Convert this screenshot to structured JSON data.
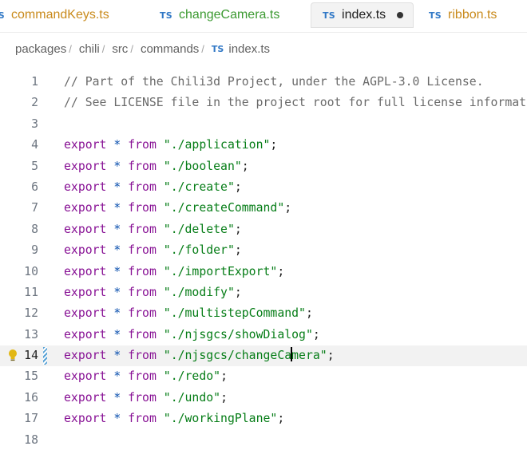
{
  "tabs": [
    {
      "label": "commandKeys.ts",
      "icon": "ts-icon",
      "icon_text": "TS",
      "state": "modified"
    },
    {
      "label": "changeCamera.ts",
      "icon": "ts-icon",
      "icon_text": "TS",
      "state": "renamed"
    },
    {
      "label": "index.ts",
      "icon": "ts-icon",
      "icon_text": "TS",
      "state": "active-unsaved"
    },
    {
      "label": "ribbon.ts",
      "icon": "ts-icon",
      "icon_text": "TS",
      "state": "modified"
    }
  ],
  "breadcrumb": {
    "items": [
      "packages",
      "chili",
      "src",
      "commands"
    ],
    "separator": "/",
    "file_icon_text": "TS",
    "file": "index.ts"
  },
  "editor": {
    "current_line": 14,
    "lines": [
      {
        "n": "1",
        "comment": "// Part of the Chili3d Project, under the AGPL-3.0 License."
      },
      {
        "n": "2",
        "comment": "// See LICENSE file in the project root for full license information."
      },
      {
        "n": "3"
      },
      {
        "n": "4",
        "kw": "export",
        "op": "*",
        "from": "from",
        "str": "\"./application\"",
        "end": ";"
      },
      {
        "n": "5",
        "kw": "export",
        "op": "*",
        "from": "from",
        "str": "\"./boolean\"",
        "end": ";"
      },
      {
        "n": "6",
        "kw": "export",
        "op": "*",
        "from": "from",
        "str": "\"./create\"",
        "end": ";"
      },
      {
        "n": "7",
        "kw": "export",
        "op": "*",
        "from": "from",
        "str": "\"./createCommand\"",
        "end": ";"
      },
      {
        "n": "8",
        "kw": "export",
        "op": "*",
        "from": "from",
        "str": "\"./delete\"",
        "end": ";"
      },
      {
        "n": "9",
        "kw": "export",
        "op": "*",
        "from": "from",
        "str": "\"./folder\"",
        "end": ";"
      },
      {
        "n": "10",
        "kw": "export",
        "op": "*",
        "from": "from",
        "str": "\"./importExport\"",
        "end": ";"
      },
      {
        "n": "11",
        "kw": "export",
        "op": "*",
        "from": "from",
        "str": "\"./modify\"",
        "end": ";"
      },
      {
        "n": "12",
        "kw": "export",
        "op": "*",
        "from": "from",
        "str": "\"./multistepCommand\"",
        "end": ";"
      },
      {
        "n": "13",
        "kw": "export",
        "op": "*",
        "from": "from",
        "str": "\"./njsgcs/showDialog\"",
        "end": ";"
      },
      {
        "n": "14",
        "kw": "export",
        "op": "*",
        "from": "from",
        "str": "\"./njsgcs/changeCamera\"",
        "caret_after": 18,
        "end": ";"
      },
      {
        "n": "15",
        "kw": "export",
        "op": "*",
        "from": "from",
        "str": "\"./redo\"",
        "end": ";"
      },
      {
        "n": "16",
        "kw": "export",
        "op": "*",
        "from": "from",
        "str": "\"./undo\"",
        "end": ";"
      },
      {
        "n": "17",
        "kw": "export",
        "op": "*",
        "from": "from",
        "str": "\"./workingPlane\"",
        "end": ";"
      },
      {
        "n": "18"
      }
    ]
  },
  "colors": {
    "ts_icon": "#3178c6",
    "modified_tab": "#c98a1b",
    "renamed_tab": "#3c9a31",
    "keyword": "#871094",
    "string": "#067d17",
    "comment": "#6a6a6a",
    "lightbulb": "#e2b714"
  }
}
